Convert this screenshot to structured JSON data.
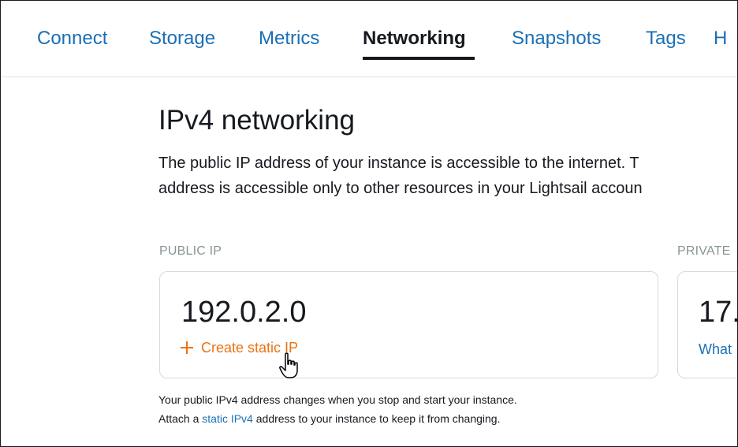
{
  "tabs": [
    {
      "label": "Connect"
    },
    {
      "label": "Storage"
    },
    {
      "label": "Metrics"
    },
    {
      "label": "Networking",
      "active": true
    },
    {
      "label": "Snapshots"
    },
    {
      "label": "Tags"
    },
    {
      "label": "H"
    }
  ],
  "section": {
    "heading": "IPv4 networking",
    "description_line1": "The public IP address of your instance is accessible to the internet. T",
    "description_line2": "address is accessible only to other resources in your Lightsail accoun"
  },
  "public_ip": {
    "label": "PUBLIC IP",
    "value": "192.0.2.0",
    "action_label": "Create static IP",
    "action_icon": "plus-icon",
    "note_line1": "Your public IPv4 address changes when you stop and start your instance.",
    "note_line2_prefix": "Attach a ",
    "note_line2_link": "static IPv4",
    "note_line2_suffix": " address to your instance to keep it from changing."
  },
  "private_ip": {
    "label": "PRIVATE",
    "value": "17.",
    "link_label": "What"
  },
  "colors": {
    "link": "#1b6fb4",
    "action": "#ec7211",
    "text": "#16191f",
    "muted": "#879596"
  }
}
